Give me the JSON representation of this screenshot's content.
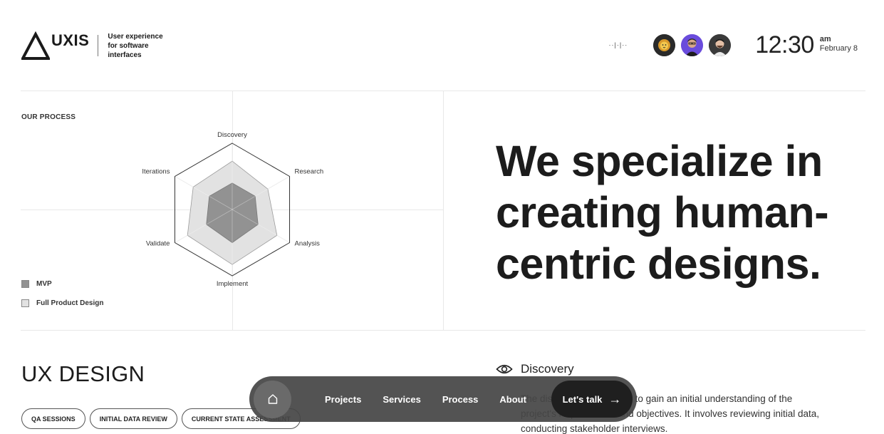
{
  "brand": {
    "name": "UXIS",
    "tagline_lines": [
      "User experience",
      "for software",
      "interfaces"
    ]
  },
  "header": {
    "wave_glyph": "··|·|··",
    "avatars": [
      "avatar-lion",
      "avatar-person-purple",
      "avatar-person-dark"
    ],
    "time": "12:30",
    "ampm": "am",
    "date": "February 8"
  },
  "process": {
    "label": "OUR PROCESS",
    "chart_data": {
      "type": "radar",
      "axes": [
        "Discovery",
        "Research",
        "Analysis",
        "Implement",
        "Validate",
        "Iterations"
      ],
      "series": [
        {
          "name": "Full Product Design",
          "values": [
            0.73,
            0.62,
            0.78,
            0.83,
            0.78,
            0.68
          ],
          "color": "#e2e2e2"
        },
        {
          "name": "MVP",
          "values": [
            0.4,
            0.4,
            0.45,
            0.5,
            0.45,
            0.4
          ],
          "color": "#929292"
        }
      ],
      "range": [
        0,
        1
      ],
      "legend_position": "bottom-left"
    },
    "legend": [
      {
        "label": "MVP",
        "color": "#929292"
      },
      {
        "label": "Full Product Design",
        "color": "#e2e2e2"
      }
    ]
  },
  "hero": {
    "lines": [
      "We specialize in",
      "creating human-",
      "centric designs."
    ]
  },
  "section": {
    "title": "UX DESIGN",
    "chips": [
      "QA SESSIONS",
      "INITIAL DATA REVIEW",
      "CURRENT STATE ASSESSMENT"
    ]
  },
  "discovery": {
    "icon": "eye-icon",
    "title": "Discovery",
    "text_line1": "The discovery phase aims to gain an initial understanding of the",
    "text_line2": "project's requirements and objectives. It involves reviewing initial data,",
    "text_line3": "conducting stakeholder interviews."
  },
  "nav": {
    "links": [
      "Projects",
      "Services",
      "Process",
      "About"
    ],
    "cta": "Let's talk",
    "cta_arrow": "→"
  }
}
